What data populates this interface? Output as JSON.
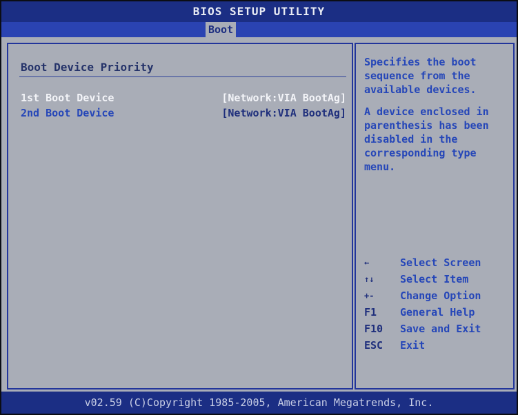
{
  "header": {
    "title": "BIOS SETUP UTILITY",
    "active_tab": "Boot"
  },
  "main": {
    "section_title": "Boot Device Priority",
    "options": [
      {
        "label": "1st Boot Device",
        "value": "[Network:VIA BootAg]"
      },
      {
        "label": "2nd Boot Device",
        "value": "[Network:VIA BootAg]"
      }
    ]
  },
  "help": {
    "paragraph_1": "Specifies the boot sequence from the available devices.",
    "paragraph_2": "A device enclosed in parenthesis has been disabled in the corresponding type menu."
  },
  "legend": [
    {
      "key": "←",
      "key_icon": "left-arrow-icon",
      "desc": "Select Screen"
    },
    {
      "key": "↑↓",
      "key_icon": "up-down-arrow-icon",
      "desc": "Select Item"
    },
    {
      "key": "+-",
      "key_icon": "plus-minus-icon",
      "desc": "Change Option"
    },
    {
      "key": "F1",
      "desc": "General Help"
    },
    {
      "key": "F10",
      "desc": "Save and Exit"
    },
    {
      "key": "ESC",
      "desc": "Exit"
    }
  ],
  "footer": {
    "copyright": "v02.59 (C)Copyright 1985-2005, American Megatrends, Inc."
  },
  "colors": {
    "background": "#a9adb7",
    "header_blue": "#1b2e84",
    "accent_blue": "#2546b8",
    "highlight_text": "#f3f4f8"
  }
}
